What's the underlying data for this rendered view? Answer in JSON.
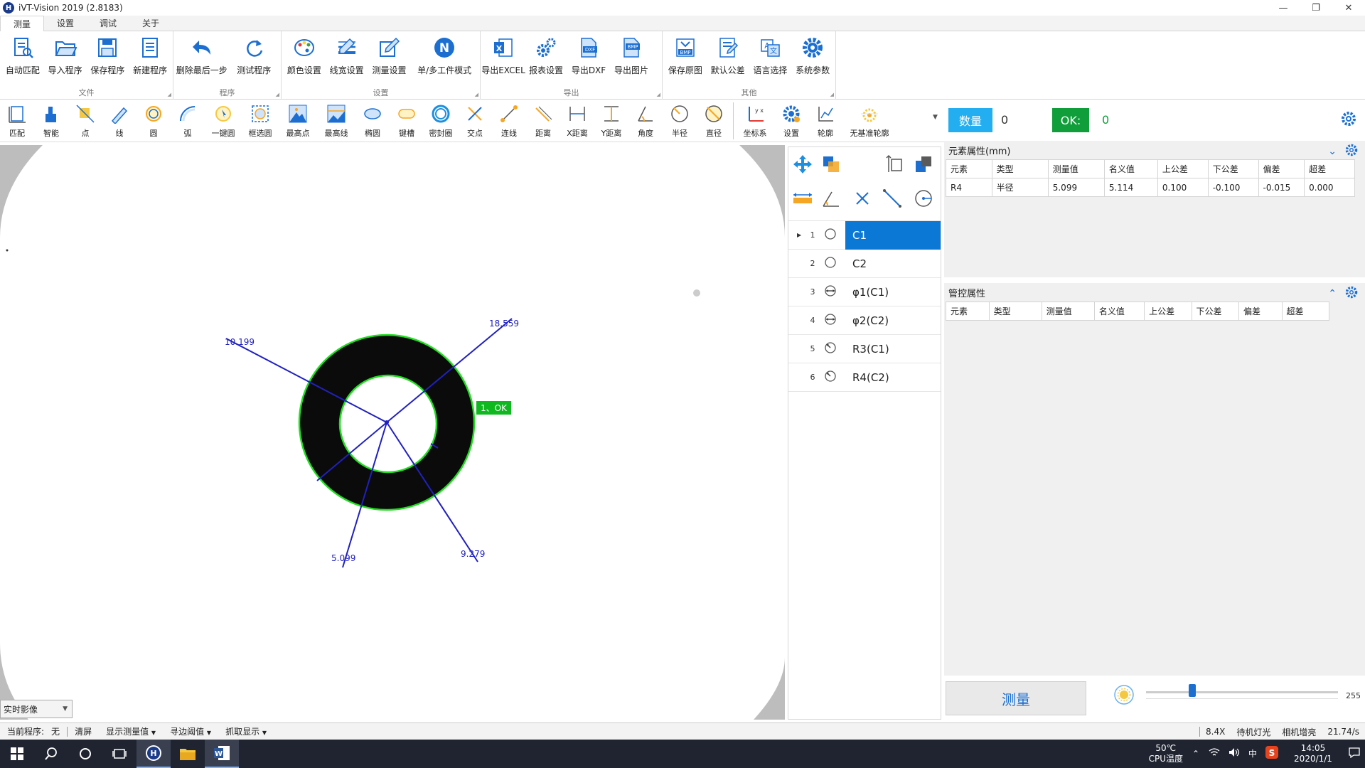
{
  "window": {
    "title": "iVT-Vision 2019  (2.8183)",
    "logo": "H"
  },
  "ribbon_tabs": [
    "测量",
    "设置",
    "调试",
    "关于"
  ],
  "ribbon_groups": [
    {
      "label": "文件",
      "buttons": [
        "自动匹配",
        "导入程序",
        "保存程序",
        "新建程序"
      ]
    },
    {
      "label": "程序",
      "buttons": [
        "删除最后一步",
        "测试程序"
      ]
    },
    {
      "label": "设置",
      "buttons": [
        "颜色设置",
        "线宽设置",
        "测量设置",
        "单/多工件模式"
      ]
    },
    {
      "label": "导出",
      "buttons": [
        "导出EXCEL",
        "报表设置",
        "导出DXF",
        "导出图片"
      ]
    },
    {
      "label": "其他",
      "buttons": [
        "保存原图",
        "默认公差",
        "语言选择",
        "系统参数"
      ]
    }
  ],
  "tools": [
    "匹配",
    "智能",
    "点",
    "线",
    "圆",
    "弧",
    "一键圆",
    "框选圆",
    "最高点",
    "最高线",
    "椭圆",
    "键槽",
    "密封圈",
    "交点",
    "连线",
    "距离",
    "X距离",
    "Y距离",
    "角度",
    "半径",
    "直径",
    "坐标系",
    "设置",
    "轮廓",
    "无基准轮廓"
  ],
  "stats": {
    "count_label": "数量",
    "count_value": "0",
    "ok_label": "OK:",
    "ok_value": "0"
  },
  "canvas": {
    "labels": {
      "a": "10.199",
      "b": "18.559",
      "c": "5.099",
      "d": "9.279"
    },
    "ok_badge": "1、OK"
  },
  "live_select": "实时影像",
  "elements": [
    {
      "num": "1",
      "name": "C1",
      "icon": "circle-icon",
      "selected": true
    },
    {
      "num": "2",
      "name": "C2",
      "icon": "circle-icon",
      "selected": false
    },
    {
      "num": "3",
      "name": "φ1(C1)",
      "icon": "diameter-icon",
      "selected": false
    },
    {
      "num": "4",
      "name": "φ2(C2)",
      "icon": "diameter-icon",
      "selected": false
    },
    {
      "num": "5",
      "name": "R3(C1)",
      "icon": "radius-icon",
      "selected": false
    },
    {
      "num": "6",
      "name": "R4(C2)",
      "icon": "radius-icon",
      "selected": false
    }
  ],
  "element_props": {
    "title": "元素属性(mm)",
    "headers": [
      "元素",
      "类型",
      "测量值",
      "名义值",
      "上公差",
      "下公差",
      "偏差",
      "超差"
    ],
    "rows": [
      [
        "R4",
        "半径",
        "5.099",
        "5.114",
        "0.100",
        "-0.100",
        "-0.015",
        "0.000"
      ]
    ]
  },
  "control_props": {
    "title": "管控属性",
    "headers": [
      "元素",
      "类型",
      "测量值",
      "名义值",
      "上公差",
      "下公差",
      "偏差",
      "超差"
    ]
  },
  "measure_button": "测量",
  "light": {
    "value": "255",
    "level_fraction": 0.24
  },
  "statusbar": {
    "program_label": "当前程序:",
    "program_value": "无",
    "clear": "清屏",
    "show_values": "显示测量值",
    "edge_threshold": "寻边阈值",
    "capture_display": "抓取显示",
    "zoom": "8.4X",
    "light_mode": "待机灯光",
    "gain": "相机增亮",
    "fps": "21.74/s"
  },
  "taskbar": {
    "cpu_temp": "50℃",
    "cpu_label": "CPU温度",
    "ime": "中",
    "time": "14:05",
    "date": "2020/1/1"
  },
  "colors": {
    "accent": "#0a78d4",
    "ok_green": "#0f9e3a",
    "count_blue": "#22aef0",
    "measure_blue": "#2020c0",
    "contour_green": "#22dd22"
  }
}
